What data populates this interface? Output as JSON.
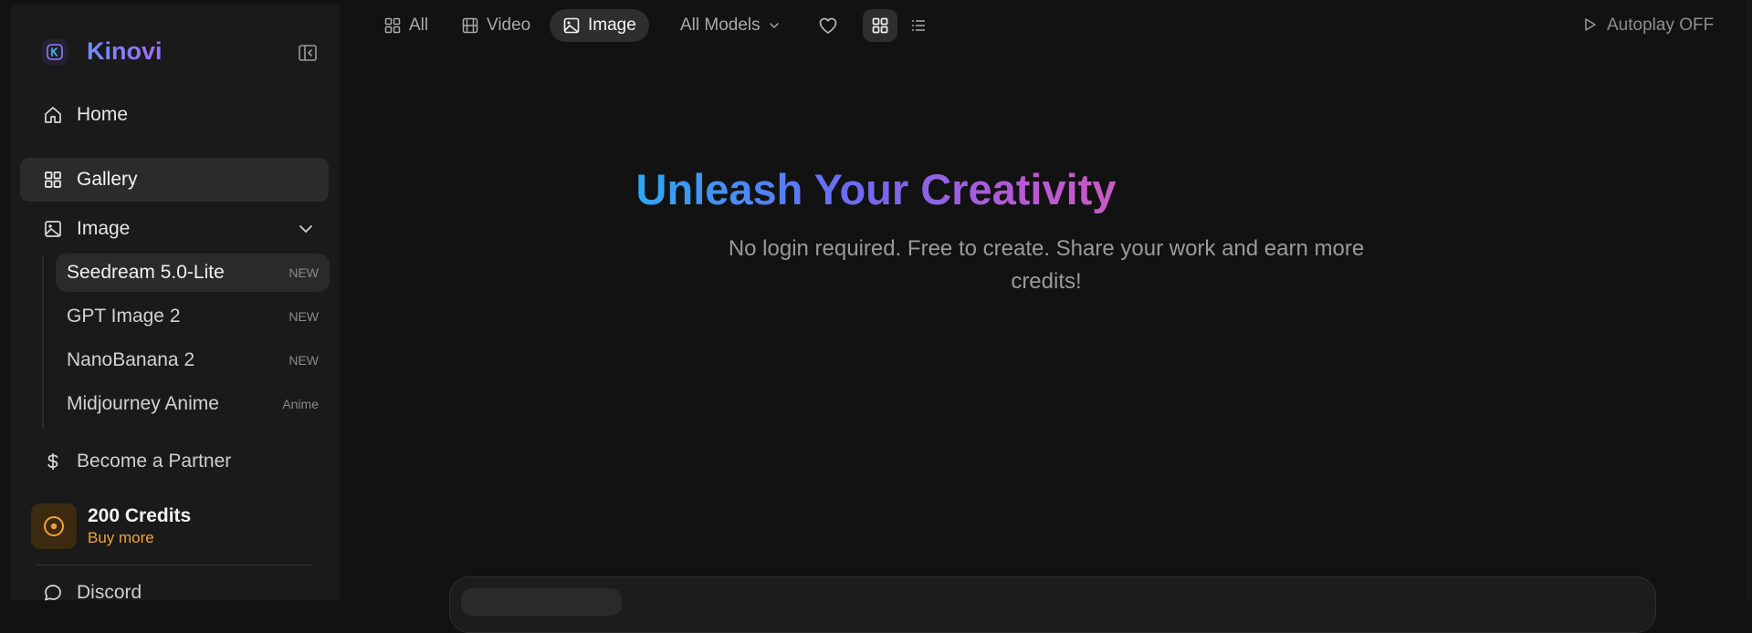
{
  "brand": {
    "name": "Kinovi"
  },
  "sidebar": {
    "home_label": "Home",
    "gallery_label": "Gallery",
    "image_label": "Image",
    "image_models": [
      {
        "label": "Seedream 5.0-Lite",
        "tag": "NEW"
      },
      {
        "label": "GPT Image 2",
        "tag": "NEW"
      },
      {
        "label": "NanoBanana 2",
        "tag": "NEW"
      },
      {
        "label": "Midjourney Anime",
        "tag": "Anime"
      }
    ],
    "partner_label": "Become a Partner",
    "credits": {
      "title": "200 Credits",
      "link": "Buy more"
    },
    "discord_label": "Discord"
  },
  "topbar": {
    "tabs": {
      "all": "All",
      "video": "Video",
      "image": "Image"
    },
    "models_select": "All Models",
    "autoplay": "Autoplay OFF"
  },
  "hero": {
    "title": "Unleash Your Creativity",
    "subtitle": "No login required. Free to create. Share your work and earn more credits!"
  },
  "colors": {
    "accent": "#7a5cff",
    "credits": "#f1a23a",
    "gradient_start": "#2ba8f5",
    "gradient_end": "#c85bc2"
  }
}
